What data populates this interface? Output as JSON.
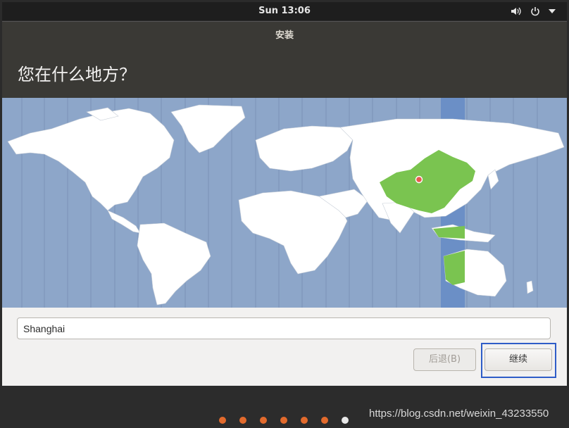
{
  "topbar": {
    "clock": "Sun 13:06",
    "icons": [
      "volume-icon",
      "power-icon",
      "dropdown-arrow-icon"
    ]
  },
  "window": {
    "title": "安装",
    "heading": "您在什么地方？"
  },
  "map": {
    "selected_region_color": "#7ac450",
    "ocean_color": "#8da6c9",
    "highlight_band_color": "#6b8fc6",
    "land_color": "#ffffff",
    "marker_color": "#e85a4f"
  },
  "location": {
    "value": "Shanghai",
    "placeholder": ""
  },
  "buttons": {
    "back_label": "后退(B)",
    "continue_label": "继续"
  },
  "progress": {
    "total_steps": 7,
    "current_step": 7,
    "dot_color": "#e26a2c",
    "active_color": "#e8e8e8"
  },
  "watermark": "https://blog.csdn.net/weixin_43233550",
  "accent": "#2f5dc8"
}
